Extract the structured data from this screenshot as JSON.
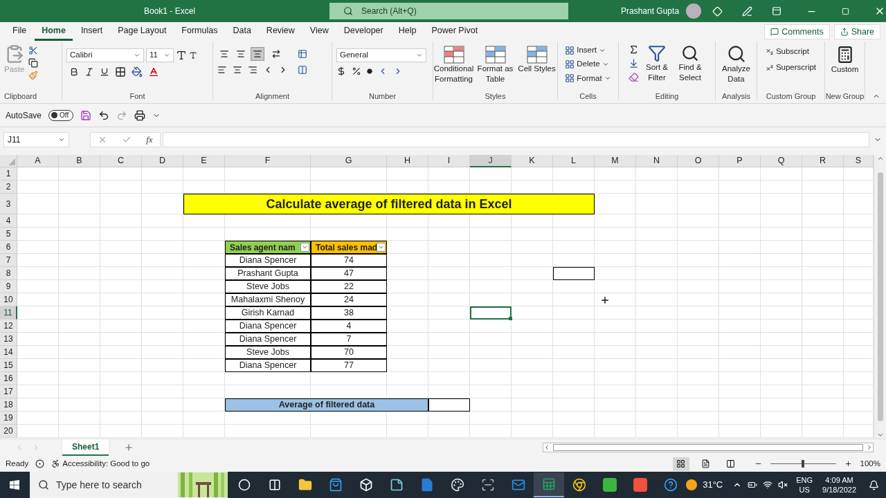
{
  "window": {
    "title": "Book1  -  Excel",
    "search_placeholder": "Search (Alt+Q)",
    "user": "Prashant Gupta"
  },
  "menu_tabs": [
    {
      "label": "File",
      "selected": false
    },
    {
      "label": "Home",
      "selected": true
    },
    {
      "label": "Insert",
      "selected": false
    },
    {
      "label": "Page Layout",
      "selected": false
    },
    {
      "label": "Formulas",
      "selected": false
    },
    {
      "label": "Data",
      "selected": false
    },
    {
      "label": "Review",
      "selected": false
    },
    {
      "label": "View",
      "selected": false
    },
    {
      "label": "Developer",
      "selected": false
    },
    {
      "label": "Help",
      "selected": false
    },
    {
      "label": "Power Pivot",
      "selected": false
    }
  ],
  "comments": "Comments",
  "share": "Share",
  "ribbon": {
    "clipboard": {
      "paste": "Paste",
      "label": "Clipboard"
    },
    "font": {
      "family": "Calibri",
      "size": "11",
      "label": "Font"
    },
    "alignment": {
      "label": "Alignment",
      "vertical": [
        {
          "selected": false
        },
        {
          "selected": false
        },
        {
          "selected": true
        }
      ]
    },
    "number": {
      "format": "General",
      "label": "Number"
    },
    "styles": {
      "label": "Styles",
      "buttons": [
        "Conditional Formatting",
        "Format as Table",
        "Cell Styles"
      ]
    },
    "cells": {
      "label": "Cells",
      "buttons": [
        "Insert",
        "Delete",
        "Format"
      ]
    },
    "editing": {
      "label": "Editing",
      "buttons": [
        "Sort & Filter",
        "Find & Select"
      ]
    },
    "analysis": {
      "label": "Analysis",
      "button": "Analyze Data"
    },
    "custom_group": {
      "label": "Custom Group",
      "buttons": [
        "Subscript",
        "Superscript"
      ]
    },
    "new_group": {
      "label": "New Group",
      "button": "Custom"
    }
  },
  "quick_access": {
    "autosave": "AutoSave",
    "autosave_on": false,
    "autosave_state": "Off"
  },
  "formula_bar": {
    "name_box": "J11",
    "function_label": "fx"
  },
  "sheet": {
    "columns": [
      {
        "label": "A",
        "selected": false
      },
      {
        "label": "B",
        "selected": false
      },
      {
        "label": "C",
        "selected": false
      },
      {
        "label": "D",
        "selected": false
      },
      {
        "label": "E",
        "selected": false
      },
      {
        "label": "F",
        "selected": false
      },
      {
        "label": "G",
        "selected": false
      },
      {
        "label": "H",
        "selected": false
      },
      {
        "label": "I",
        "selected": false
      },
      {
        "label": "J",
        "selected": true
      },
      {
        "label": "K",
        "selected": false
      },
      {
        "label": "L",
        "selected": false
      },
      {
        "label": "M",
        "selected": false
      },
      {
        "label": "N",
        "selected": false
      },
      {
        "label": "O",
        "selected": false
      },
      {
        "label": "P",
        "selected": false
      },
      {
        "label": "Q",
        "selected": false
      },
      {
        "label": "R",
        "selected": false
      },
      {
        "label": "S",
        "selected": false
      }
    ],
    "rows": [
      {
        "label": "1",
        "selected": false
      },
      {
        "label": "2",
        "selected": false
      },
      {
        "label": "3",
        "selected": false
      },
      {
        "label": "4",
        "selected": false
      },
      {
        "label": "5",
        "selected": false
      },
      {
        "label": "6",
        "selected": false
      },
      {
        "label": "7",
        "selected": false
      },
      {
        "label": "8",
        "selected": false
      },
      {
        "label": "9",
        "selected": false
      },
      {
        "label": "10",
        "selected": false
      },
      {
        "label": "11",
        "selected": true
      },
      {
        "label": "12",
        "selected": false
      },
      {
        "label": "13",
        "selected": false
      },
      {
        "label": "14",
        "selected": false
      },
      {
        "label": "15",
        "selected": false
      },
      {
        "label": "16",
        "selected": false
      },
      {
        "label": "17",
        "selected": false
      },
      {
        "label": "18",
        "selected": false
      },
      {
        "label": "19",
        "selected": false
      },
      {
        "label": "20",
        "selected": false
      }
    ],
    "title": "Calculate average of filtered data in Excel",
    "table": {
      "headers": [
        {
          "label": "Sales agent nam",
          "color": "#92d050"
        },
        {
          "label": "Total sales mad",
          "color": "#ffc000"
        }
      ],
      "rows": [
        [
          "Diana Spencer",
          "74"
        ],
        [
          "Prashant Gupta",
          "47"
        ],
        [
          "Steve Jobs",
          "22"
        ],
        [
          "Mahalaxmi Shenoy",
          "24"
        ],
        [
          "Girish Karnad",
          "38"
        ],
        [
          "Diana Spencer",
          "4"
        ],
        [
          "Diana Spencer",
          "7"
        ],
        [
          "Steve Jobs",
          "70"
        ],
        [
          "Diana Spencer",
          "77"
        ]
      ]
    },
    "summary": {
      "label": "Average of filtered data"
    }
  },
  "sheet_tabs": [
    {
      "label": "Sheet1",
      "selected": true
    }
  ],
  "status_bar": {
    "mode": "Ready",
    "accessibility": "Accessibility: Good to go",
    "views": [
      {
        "kind": "normal",
        "selected": true
      },
      {
        "kind": "page_layout",
        "selected": false
      },
      {
        "kind": "page_break",
        "selected": false
      }
    ],
    "zoom": {
      "level": 0.5,
      "reading": "100%"
    }
  },
  "taskbar": {
    "search_placeholder": "Type here to search",
    "apps": [
      {
        "kind": "cortana",
        "selected": false
      },
      {
        "kind": "task_view",
        "selected": false
      },
      {
        "kind": "explorer",
        "selected": false
      },
      {
        "kind": "store",
        "selected": false
      },
      {
        "kind": "dropbox",
        "selected": false
      },
      {
        "kind": "notes",
        "selected": false
      },
      {
        "kind": "word",
        "selected": false
      },
      {
        "kind": "paint",
        "selected": false
      },
      {
        "kind": "scanner",
        "selected": false
      },
      {
        "kind": "outlook",
        "selected": false
      },
      {
        "kind": "excel",
        "selected": true
      },
      {
        "kind": "chrome",
        "selected": false
      },
      {
        "kind": "camtasia_green",
        "selected": false
      },
      {
        "kind": "camtasia_orange",
        "selected": false
      },
      {
        "kind": "help",
        "selected": false
      }
    ],
    "weather": "31°C",
    "language": "ENG",
    "region": "US",
    "time": "4:09 AM",
    "date": "9/18/2022"
  }
}
